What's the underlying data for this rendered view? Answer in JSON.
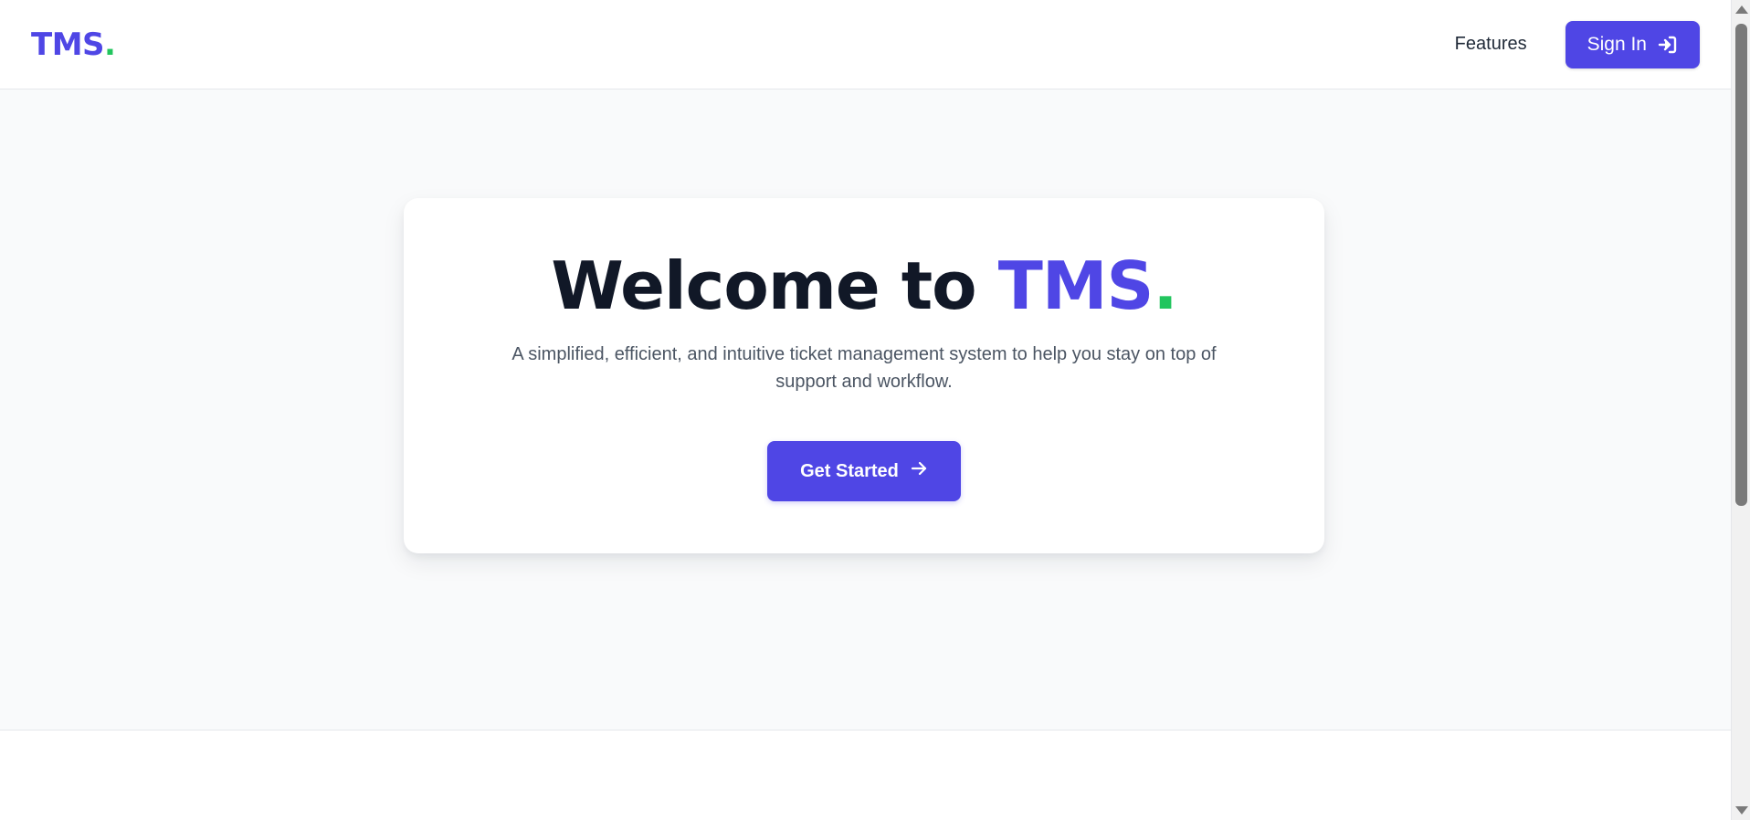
{
  "header": {
    "logo_text": "TMS",
    "logo_dot": ".",
    "nav": {
      "features_label": "Features",
      "signin_label": "Sign In",
      "signin_icon": "sign-in-icon"
    }
  },
  "hero": {
    "title_prefix": "Welcome to ",
    "title_brand": "TMS",
    "title_dot": ".",
    "subtitle": "A simplified, efficient, and intuitive ticket management system to help you stay on top of support and workflow.",
    "cta_label": "Get Started",
    "cta_icon": "arrow-right-icon"
  },
  "colors": {
    "accent": "#4f46e5",
    "accent_dot": "#22c55e",
    "heading": "#111827",
    "body_text": "#4b5563",
    "page_bg": "#f9fafb"
  }
}
